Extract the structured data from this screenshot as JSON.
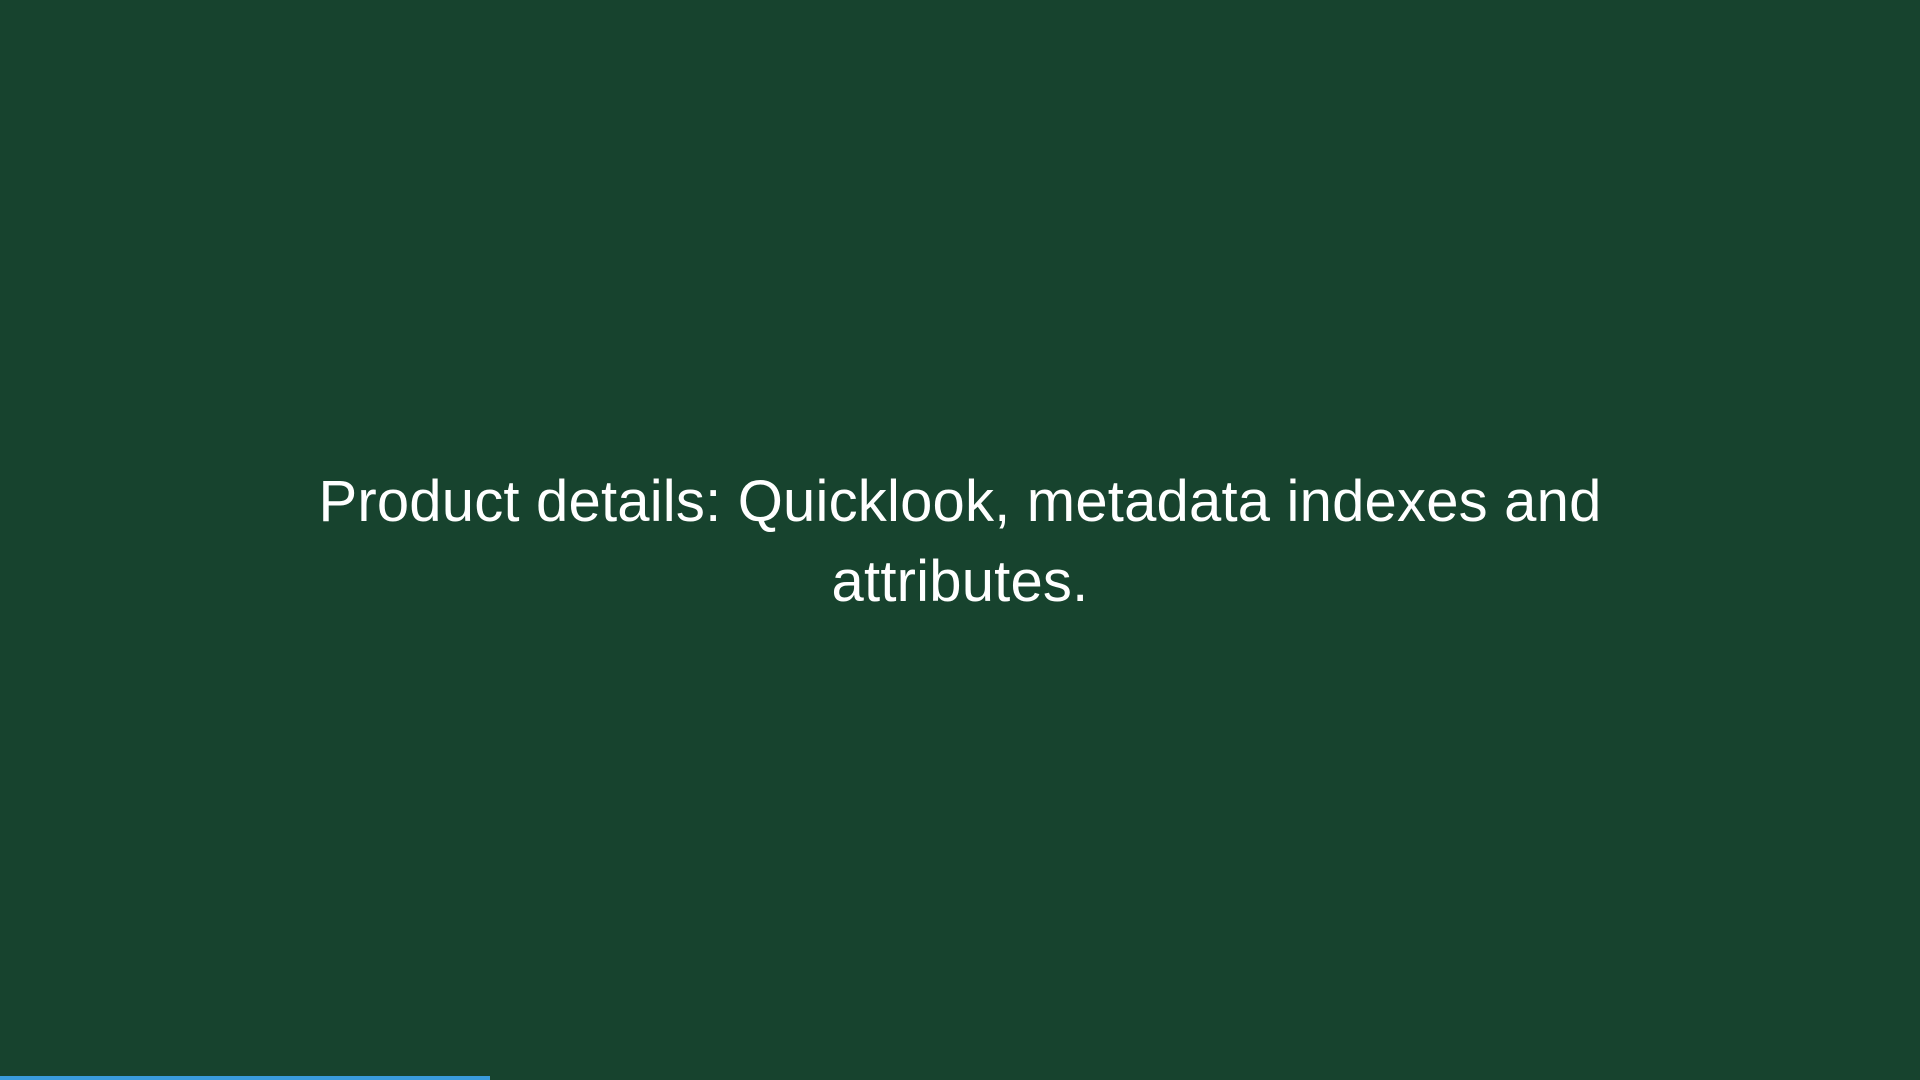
{
  "slide": {
    "caption": "Product details: Quicklook, metadata indexes and attributes."
  },
  "progress": {
    "value": 0.255
  },
  "colors": {
    "background": "#17432e",
    "text": "#ffffff",
    "progress_fill": "#3a9bdc"
  }
}
